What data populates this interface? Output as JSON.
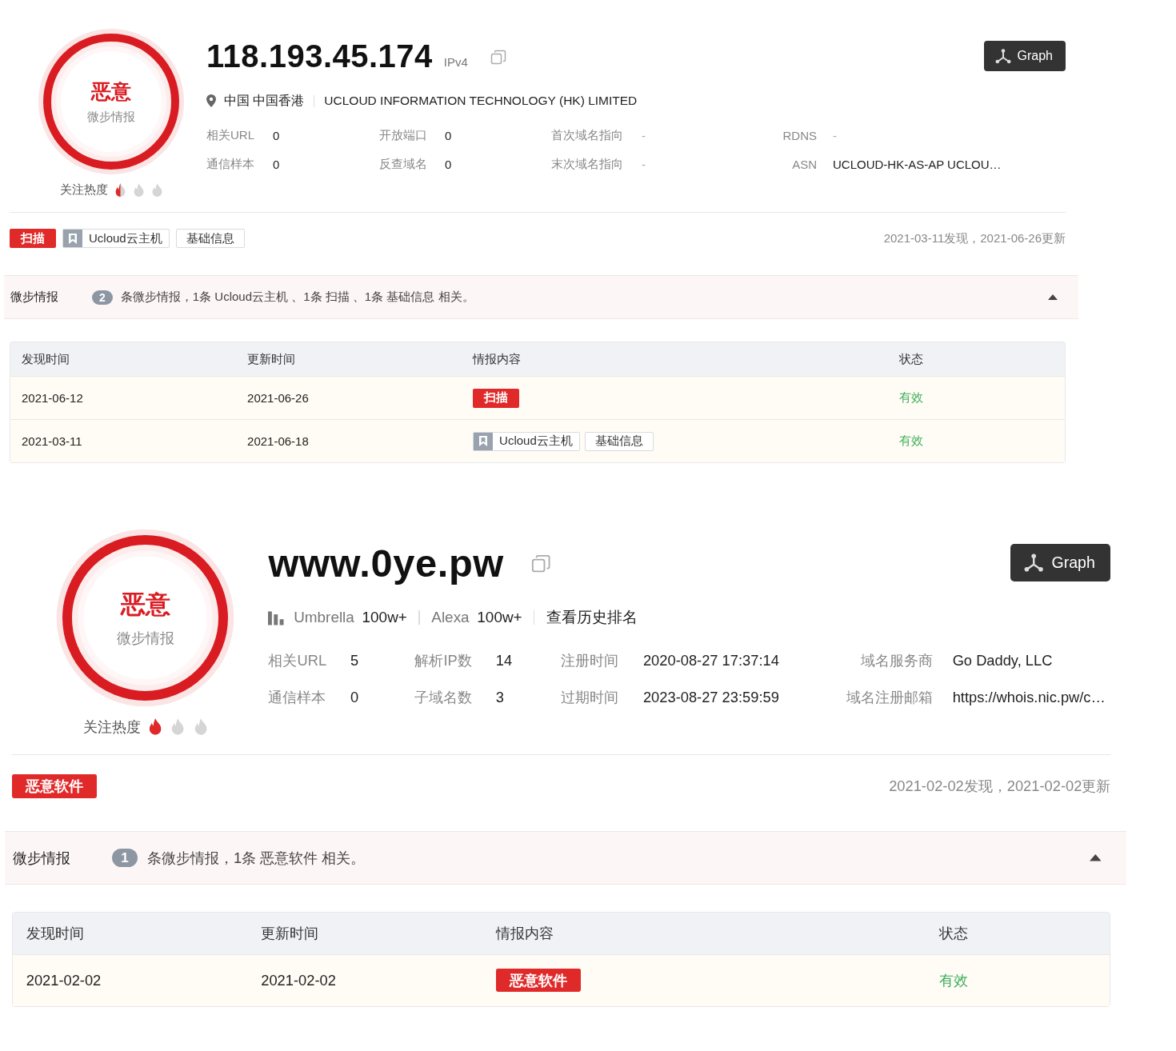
{
  "reports": [
    {
      "verdict": "恶意",
      "verdict_source": "微步情报",
      "heat": {
        "label": "关注热度",
        "stars": 0.5
      },
      "title": "118.193.45.174",
      "title_type": "IPv4",
      "graph_button": "Graph",
      "subline": [
        {
          "kind": "location",
          "text": "中国 中国香港"
        },
        {
          "kind": "org",
          "text": "UCLOUD INFORMATION TECHNOLOGY (HK) LIMITED"
        }
      ],
      "fields": [
        {
          "label": "相关URL",
          "value": "0",
          "muted": false
        },
        {
          "label": "开放端口",
          "value": "0",
          "muted": false
        },
        {
          "label": "首次域名指向",
          "value": "-",
          "muted": true
        },
        {
          "label": "RDNS",
          "value": "-",
          "muted": true
        },
        {
          "label": "通信样本",
          "value": "0",
          "muted": false
        },
        {
          "label": "反查域名",
          "value": "0",
          "muted": false
        },
        {
          "label": "末次域名指向",
          "value": "-",
          "muted": true
        },
        {
          "label": "ASN",
          "value": "UCLOUD-HK-AS-AP UCLOU…",
          "muted": false
        }
      ],
      "tags": [
        {
          "kind": "danger",
          "text": "扫描"
        },
        {
          "kind": "bookmark",
          "text": "Ucloud云主机"
        },
        {
          "kind": "plain",
          "text": "基础信息"
        }
      ],
      "dates": "2021-03-11发现，2021-06-26更新",
      "intel": {
        "label": "微步情报",
        "count": "2",
        "summary": "条微步情报，1条 Ucloud云主机 、1条 扫描 、1条 基础信息 相关。",
        "expanded": true
      },
      "table": {
        "columns": [
          "发现时间",
          "更新时间",
          "情报内容",
          "状态"
        ],
        "rows": [
          {
            "found": "2021-06-12",
            "updated": "2021-06-26",
            "tags": [
              {
                "kind": "danger",
                "text": "扫描"
              }
            ],
            "status": "有效"
          },
          {
            "found": "2021-03-11",
            "updated": "2021-06-18",
            "tags": [
              {
                "kind": "bookmark",
                "text": "Ucloud云主机"
              },
              {
                "kind": "plain",
                "text": "基础信息"
              }
            ],
            "status": "有效"
          }
        ]
      }
    },
    {
      "verdict": "恶意",
      "verdict_source": "微步情报",
      "heat": {
        "label": "关注热度",
        "stars": 1
      },
      "title": "www.0ye.pw",
      "graph_button": "Graph",
      "subline": [
        {
          "kind": "rank",
          "label": "Umbrella",
          "value": "100w+"
        },
        {
          "kind": "rank",
          "label": "Alexa",
          "value": "100w+"
        },
        {
          "kind": "link",
          "text": "查看历史排名"
        }
      ],
      "fields": [
        {
          "label": "相关URL",
          "value": "5",
          "muted": false
        },
        {
          "label": "解析IP数",
          "value": "14",
          "muted": false
        },
        {
          "label": "注册时间",
          "value": "2020-08-27 17:37:14",
          "muted": false
        },
        {
          "label": "域名服务商",
          "value": "Go Daddy, LLC",
          "muted": false
        },
        {
          "label": "通信样本",
          "value": "0",
          "muted": false
        },
        {
          "label": "子域名数",
          "value": "3",
          "muted": false
        },
        {
          "label": "过期时间",
          "value": "2023-08-27 23:59:59",
          "muted": false
        },
        {
          "label": "域名注册邮箱",
          "value": "https://whois.nic.pw/c…",
          "muted": false
        }
      ],
      "tags": [
        {
          "kind": "danger",
          "text": "恶意软件"
        }
      ],
      "dates": "2021-02-02发现，2021-02-02更新",
      "intel": {
        "label": "微步情报",
        "count": "1",
        "summary": "条微步情报，1条 恶意软件 相关。",
        "expanded": true
      },
      "table": {
        "columns": [
          "发现时间",
          "更新时间",
          "情报内容",
          "状态"
        ],
        "rows": [
          {
            "found": "2021-02-02",
            "updated": "2021-02-02",
            "tags": [
              {
                "kind": "danger",
                "text": "恶意软件"
              }
            ],
            "status": "有效"
          }
        ]
      }
    }
  ]
}
